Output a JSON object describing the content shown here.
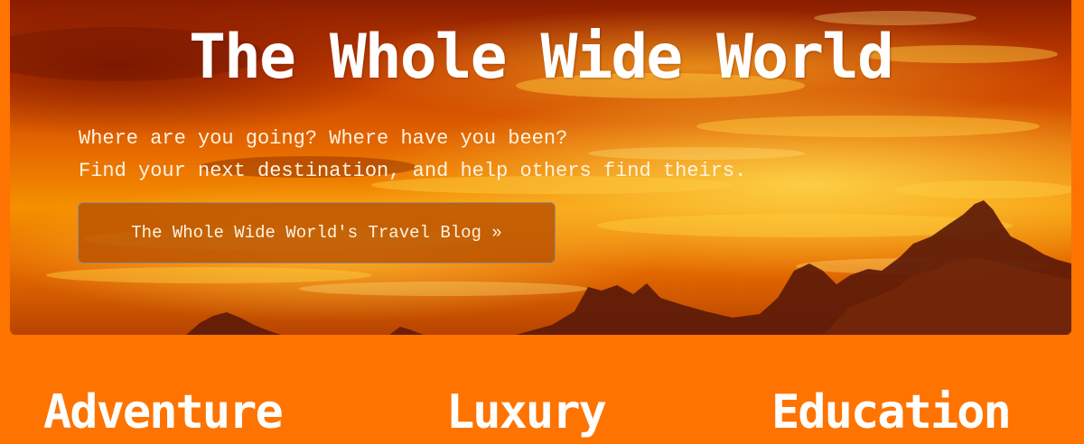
{
  "hero": {
    "title": "The Whole Wide World",
    "tagline_line1": "Where are you going? Where have you been?",
    "tagline_line2": "Find your next destination, and help others find theirs.",
    "blog_button_label": "The Whole Wide World's Travel Blog »"
  },
  "categories": [
    {
      "label": "Adventure"
    },
    {
      "label": "Luxury"
    },
    {
      "label": "Education"
    }
  ],
  "colors": {
    "page_background": "#ff7300",
    "text": "#ffffff",
    "button_background": "#b95000"
  }
}
